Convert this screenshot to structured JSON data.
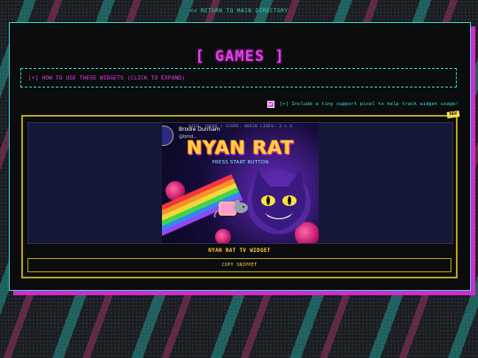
{
  "nav": {
    "return_link": "<< RETURN TO MAIN DIRECTORY"
  },
  "page": {
    "title": "[ GAMES ]"
  },
  "howto": {
    "label": "[+] HOW TO USE THESE WIDGETS (CLICK TO EXPAND)"
  },
  "support_pixel": {
    "checked": true,
    "label": "[+] Include a tiny support pixel to help track widget usage!"
  },
  "widget": {
    "badge": "NEW",
    "caption": "NYAN RAT TV WIDGET",
    "copy_label": "COPY SNIPPET",
    "video": {
      "channel_name": "Brodie Dunham",
      "channel_handle": "@bmd...",
      "hud": "HIGH: 10000 | SCORE: 00420   LIVES: 3 x 4",
      "game_title": "NYAN RAT",
      "press_start": "PRESS START BUTTON"
    }
  },
  "colors": {
    "accent_cyan": "#38d9d3",
    "accent_magenta": "#e040e8",
    "accent_gold": "#b6a222",
    "panel_bg": "#0b0c0d"
  }
}
